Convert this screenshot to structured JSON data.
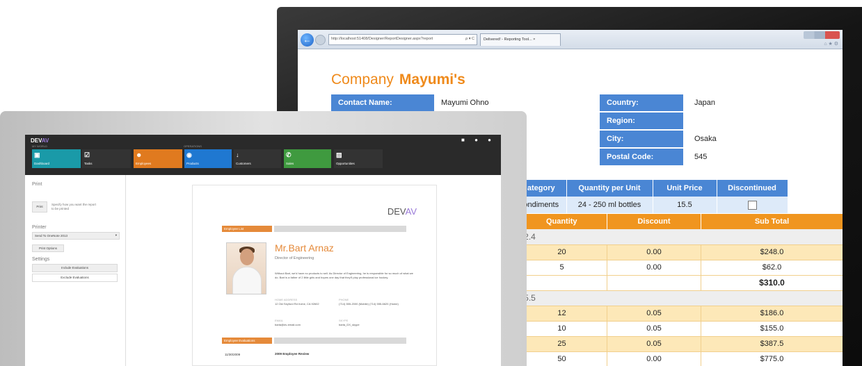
{
  "browser": {
    "address": "http://localhost:51408/Designer/ReportDesigner.aspx?report",
    "address_btns": "ρ ▾ C",
    "tab": "Delivered! - Reporting Tool...  ×",
    "back_icon": "←",
    "sys_icons": "⌂ ★ ⚙"
  },
  "report": {
    "company_label": "Company",
    "company_name": "Mayumi's",
    "labels": {
      "contact": "Contact Name:",
      "country": "Country:",
      "region": "Region:",
      "city": "City:",
      "postal": "Postal Code:"
    },
    "values": {
      "contact": "Mayumi Ohno",
      "country": "Japan",
      "region": "",
      "city": "Osaka",
      "postal": "545"
    },
    "product_headers": [
      "ategory",
      "Quantity per Unit",
      "Unit Price",
      "Discontinued"
    ],
    "product_row": [
      "ondiments",
      "24 - 250 ml bottles",
      "15.5"
    ],
    "order_headers": [
      "Quantity",
      "Discount",
      "Sub Total"
    ],
    "groups": [
      {
        "price": "12.4",
        "rows": [
          {
            "qty": "20",
            "disc": "0.00",
            "sub": "$248.0"
          },
          {
            "qty": "5",
            "disc": "0.00",
            "sub": "$62.0"
          }
        ],
        "total": "$310.0"
      },
      {
        "price": "15.5",
        "rows": [
          {
            "qty": "12",
            "disc": "0.05",
            "sub": "$186.0"
          },
          {
            "qty": "10",
            "disc": "0.05",
            "sub": "$155.0"
          },
          {
            "qty": "25",
            "disc": "0.05",
            "sub": "$387.5"
          },
          {
            "qty": "50",
            "disc": "0.00",
            "sub": "$775.0"
          }
        ]
      }
    ]
  },
  "devav": {
    "logo_a": "DEV",
    "logo_b": "AV",
    "controls": "■ ● ●",
    "caption_my_world": "MY WORLD",
    "caption_operations": "OPERATIONS",
    "tiles": [
      {
        "label": "Dashboard",
        "icon": "▣",
        "color": "#1a9aa8"
      },
      {
        "label": "Tasks",
        "icon": "☑",
        "color": "#333333"
      },
      {
        "label": "Employees",
        "icon": "☻",
        "color": "#e07a1f"
      },
      {
        "label": "Products",
        "icon": "◉",
        "color": "#1f78d1"
      },
      {
        "label": "Customers",
        "icon": "↓",
        "color": "#333333"
      },
      {
        "label": "Sales",
        "icon": "✆",
        "color": "#3f9a3f"
      },
      {
        "label": "Opportunities",
        "icon": "▨",
        "color": "#333333"
      }
    ],
    "left": {
      "print_title": "Print",
      "print_button": "Print",
      "print_hint": "Specify how you want the report to be printed",
      "printer_title": "Printer",
      "printer_value": "Send To OneNote 2013",
      "print_options": "Print Options",
      "settings_title": "Settings",
      "include": "Include Evaluations",
      "exclude": "Exclude Evaluations"
    },
    "doc": {
      "logo_a": "DEV",
      "logo_b": "AV",
      "section_employee": "Employee List",
      "name": "Mr.Bart Arnaz",
      "title": "Director of Engineering",
      "bio": "Without Bart, we'd have no products to sell. As Director of Engineering, he is responsible for so much of what we do. Bart is a father of 2 little girls and hopes one day that they'll play professional ice hockey.",
      "home_address_label": "HOME ADDRESS",
      "home_address": "12 Old Seyford Rd Irvine, CA 92602",
      "phone_label": "PHONE",
      "phone": "(714) 555-2000 (Mobile) (714) 555-6620 (Home)",
      "email_label": "EMAIL",
      "email": "barta@dv-email.com",
      "skype_label": "SKYPE",
      "skype": "barta_DX_skype",
      "section_evals": "Employee Evaluations",
      "eval_date": "11/30/2009",
      "eval_title": "2009 Employee Review"
    }
  }
}
